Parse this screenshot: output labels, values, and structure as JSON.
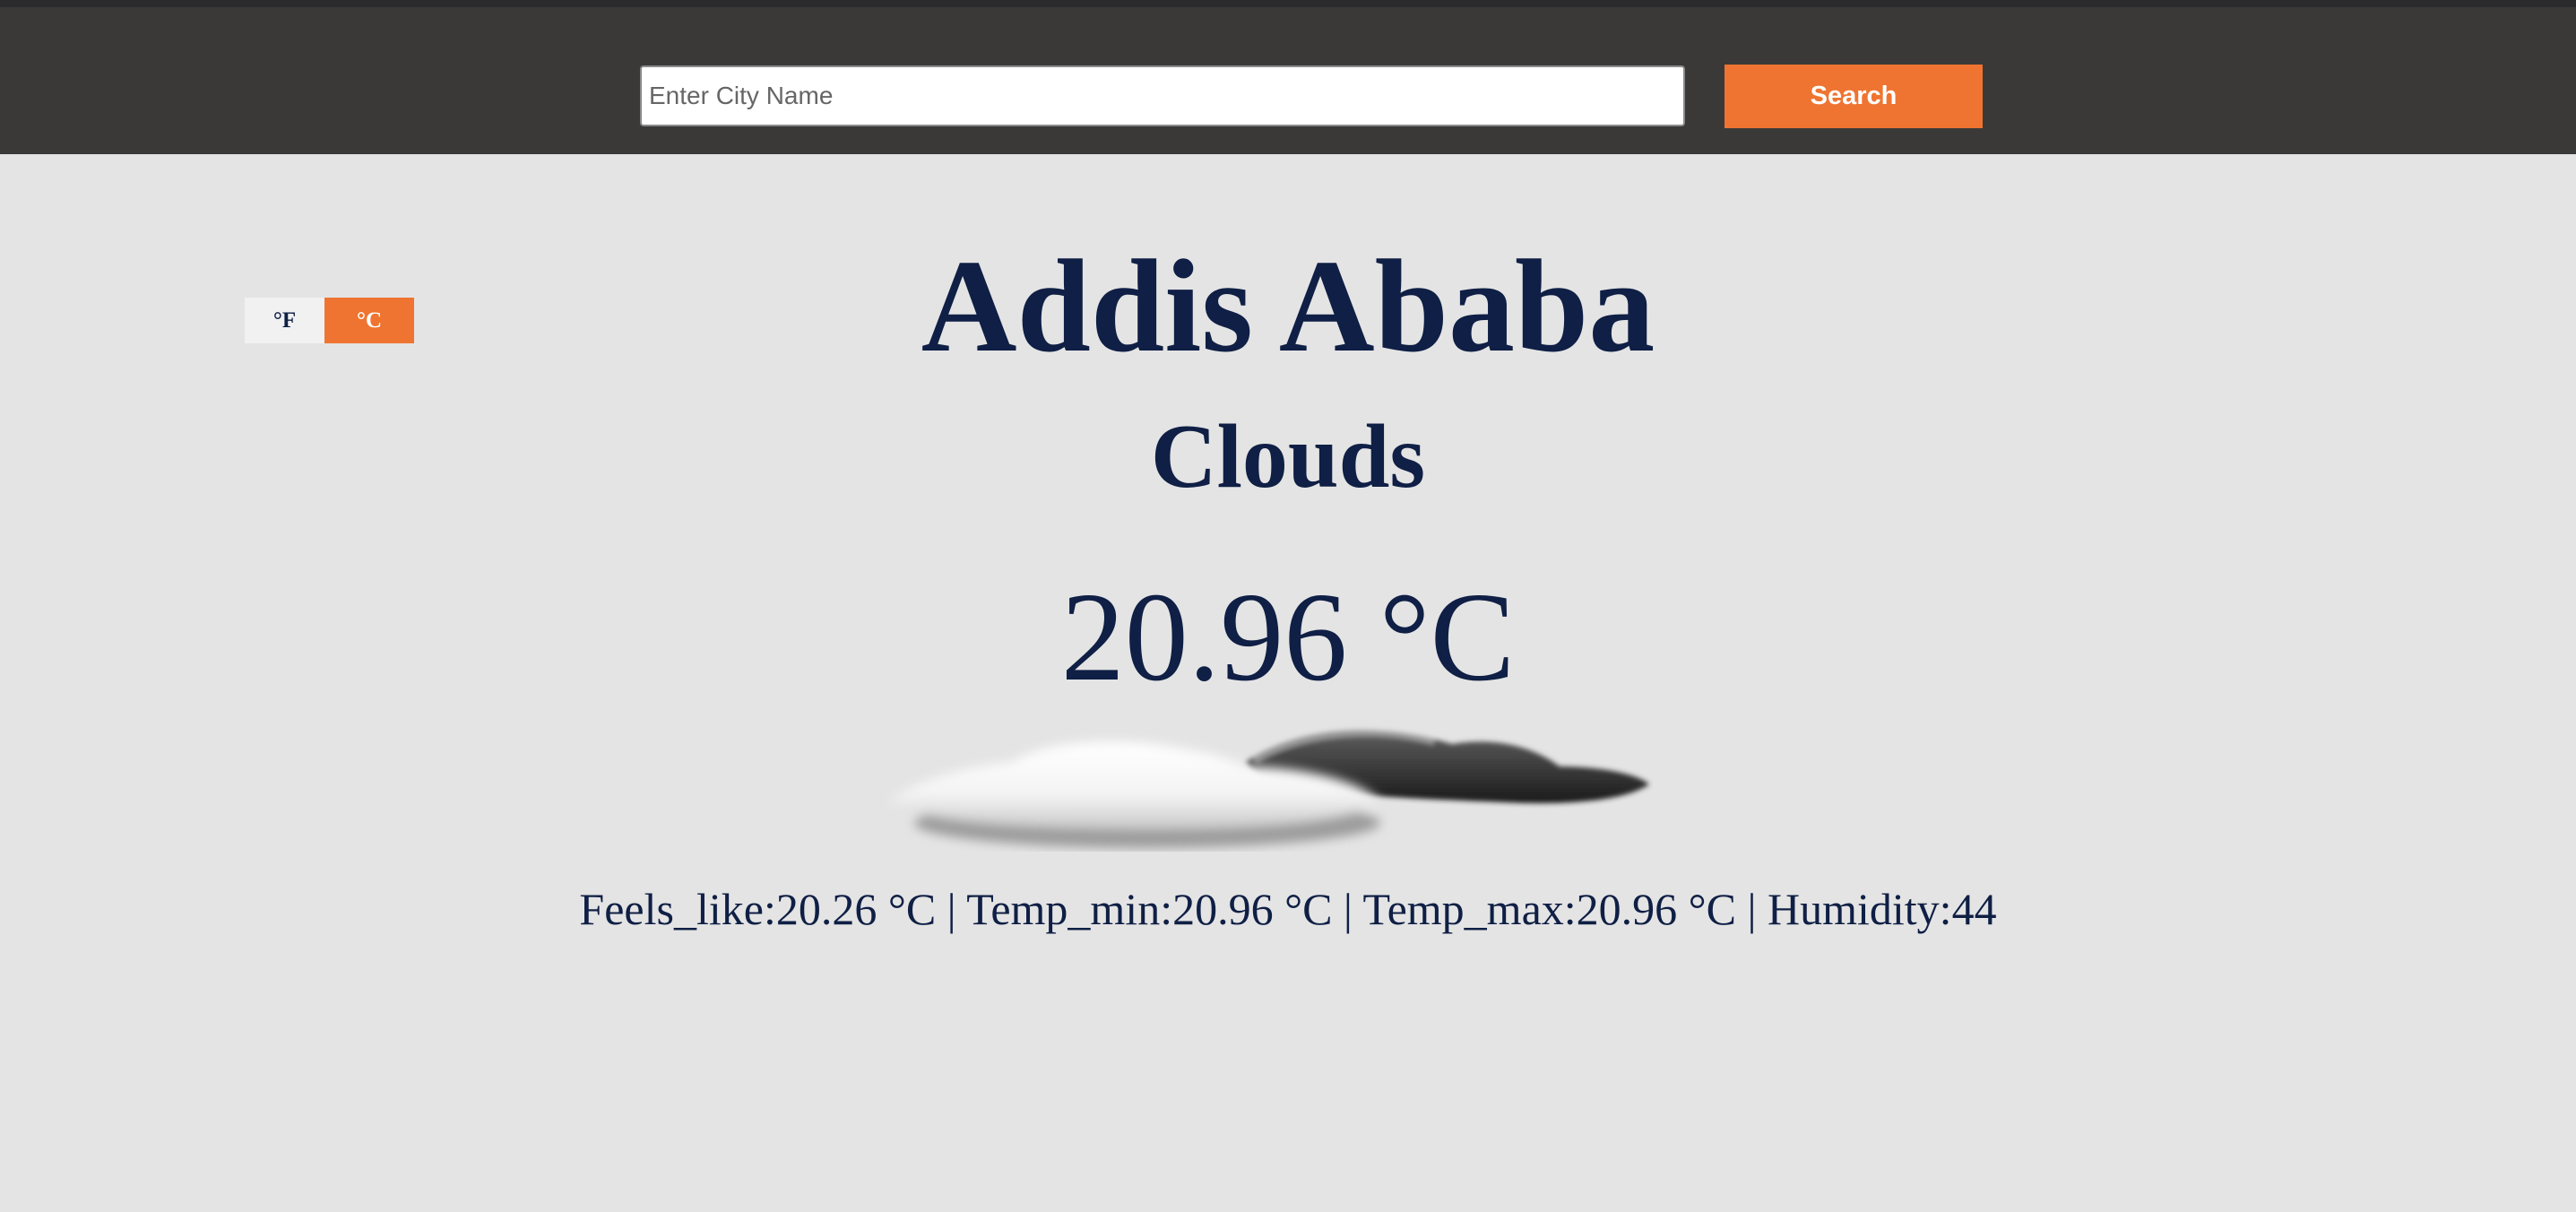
{
  "header": {
    "search_placeholder": "Enter City Name",
    "search_value": "",
    "search_button_label": "Search"
  },
  "unit_toggle": {
    "fahrenheit_label": "°F",
    "celsius_label": "°C",
    "selected": "°C"
  },
  "weather": {
    "city": "Addis Ababa",
    "condition": "Clouds",
    "temperature": "20.96 °C",
    "icon": "clouds-icon",
    "details": "Feels_like:20.26 °C | Temp_min:20.96 °C | Temp_max:20.96 °C | Humidity:44"
  },
  "colors": {
    "header_bg": "#3b3938",
    "page_bg": "#e4e4e4",
    "accent": "#ef7431",
    "text": "#0f1f45"
  }
}
